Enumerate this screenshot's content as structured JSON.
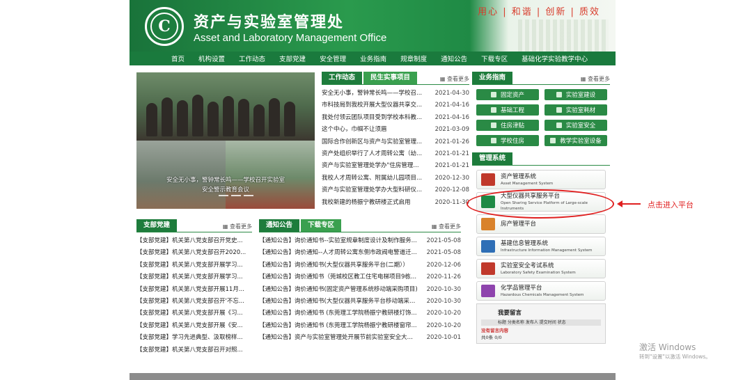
{
  "header": {
    "title_cn": "资产与实验室管理处",
    "title_en": "Asset and Laboratory Management Office",
    "motto": "用心 | 和谐 | 创新 | 质效",
    "logo_glyph": "C"
  },
  "nav": [
    "首页",
    "机构设置",
    "工作动态",
    "支部党建",
    "安全管理",
    "业务指南",
    "规章制度",
    "通知公告",
    "下载专区",
    "基础化学实验教学中心"
  ],
  "photo": {
    "caption_line1": "安全无小事，警钟常长鸣——学校召开实验室",
    "caption_line2": "安全警示教育会议"
  },
  "work": {
    "tabs": [
      "工作动态",
      "民生实事项目"
    ],
    "more": "查看更多",
    "items": [
      {
        "title": "安全无小事，警钟常长鸣——学校召...",
        "date": "2021-04-30"
      },
      {
        "title": "市科技局到我校开展大型仪器共享交...",
        "date": "2021-04-16"
      },
      {
        "title": "我处付领云团队项目受到学校本科教...",
        "date": "2021-04-16"
      },
      {
        "title": "这个中心，巾帼不让须眉",
        "date": "2021-03-09"
      },
      {
        "title": "国际合作创新区与资产与实验室管理...",
        "date": "2021-01-26"
      },
      {
        "title": "资产处组织举行了人才周转公寓（幼...",
        "date": "2021-01-21"
      },
      {
        "title": "资产与实验室管理处学办\"住房管理...",
        "date": "2021-01-21"
      },
      {
        "title": "我校人才周转公寓、附属幼儿园项目...",
        "date": "2020-12-30"
      },
      {
        "title": "资产与实验室管理处学办大型科研仪...",
        "date": "2020-12-08"
      },
      {
        "title": "我校新建的杨振宁教研楼正式启用",
        "date": "2020-11-30"
      }
    ]
  },
  "guide": {
    "title": "业务指南",
    "more": "查看更多",
    "buttons": [
      "固定资产",
      "实验室建设",
      "基础工程",
      "实验室耗材",
      "住房津贴",
      "实验室安全",
      "学校住房",
      "教学实验室设备"
    ]
  },
  "systems": {
    "title": "管理系统",
    "items": [
      {
        "name": "资产管理系统",
        "en": "Asset Management System",
        "color": "#c0392b"
      },
      {
        "name": "大型仪器共享服务平台",
        "en": "Open Sharing Service Platform of Large-scale Instruments",
        "color": "#1f8a45"
      },
      {
        "name": "房产管理平台",
        "en": "",
        "color": "#d9822b"
      },
      {
        "name": "基建信息管理系统",
        "en": "Infrastructure Information Management System",
        "color": "#2f6fb6"
      },
      {
        "name": "实验室安全考试系统",
        "en": "Laboratory Safety Examination System",
        "color": "#c0392b"
      },
      {
        "name": "化学品管理平台",
        "en": "Hazardous Chemicals Management System",
        "color": "#8e44ad"
      }
    ]
  },
  "message": {
    "title": "我要留言",
    "header": "标题         分类名称  发布人  提交时间   状态",
    "empty": "没有留言内容",
    "count": "共0条      0/0"
  },
  "party": {
    "title": "支部党建",
    "more": "查看更多",
    "items": [
      "【支部党建】机关第八党支部召开党史...",
      "【支部党建】机关第八党支部召开2020...",
      "【支部党建】机关第八党支部开展学习...",
      "【支部党建】机关第八党支部开展学习...",
      "【支部党建】机关第八党支部开展11月...",
      "【支部党建】机关第八党支部召开'不忘...",
      "【支部党建】机关第八党支部开展《习...",
      "【支部党建】机关第八党支部开展《安...",
      "【支部党建】学习先进典型、汲取榜样...",
      "【支部党建】机关第八党支部召开对照..."
    ]
  },
  "notice": {
    "tabs": [
      "通知公告",
      "下载专区"
    ],
    "more": "查看更多",
    "items": [
      {
        "title": "【通知公告】询价通知书--实验室规章制度设计及制作服务...",
        "date": "2021-05-08"
      },
      {
        "title": "【通知公告】询价通知--人才周转公寓东侧市政阀电警道迁...",
        "date": "2021-05-08"
      },
      {
        "title": "【通知公告】询价通知书(大型仪器共享服务平台(二期））",
        "date": "2020-12-06"
      },
      {
        "title": "【通知公告】询价通知书（莞城校区教工住宅电梯项目9栋...",
        "date": "2020-11-26"
      },
      {
        "title": "【通知公告】询价通知书(固定资产管理系统移动端采购项目)",
        "date": "2020-10-30"
      },
      {
        "title": "【通知公告】询价通知书(大型仪器共享服务平台移动端采购...",
        "date": "2020-10-30"
      },
      {
        "title": "【通知公告】询价通知书  (东莞理工学院杨振宁教研楼灯饰...",
        "date": "2020-10-20"
      },
      {
        "title": "【通知公告】询价通知书  (东莞理工学院杨振宁教研楼窗帘...",
        "date": "2020-10-20"
      },
      {
        "title": "【通知公告】资产与实验室管理处开展节前实验室安全大检查",
        "date": "2020-10-01"
      }
    ]
  },
  "annotation": "点击进入平台",
  "watermark": {
    "line1": "激活 Windows",
    "line2": "转到\"设置\"以激活 Windows。"
  }
}
